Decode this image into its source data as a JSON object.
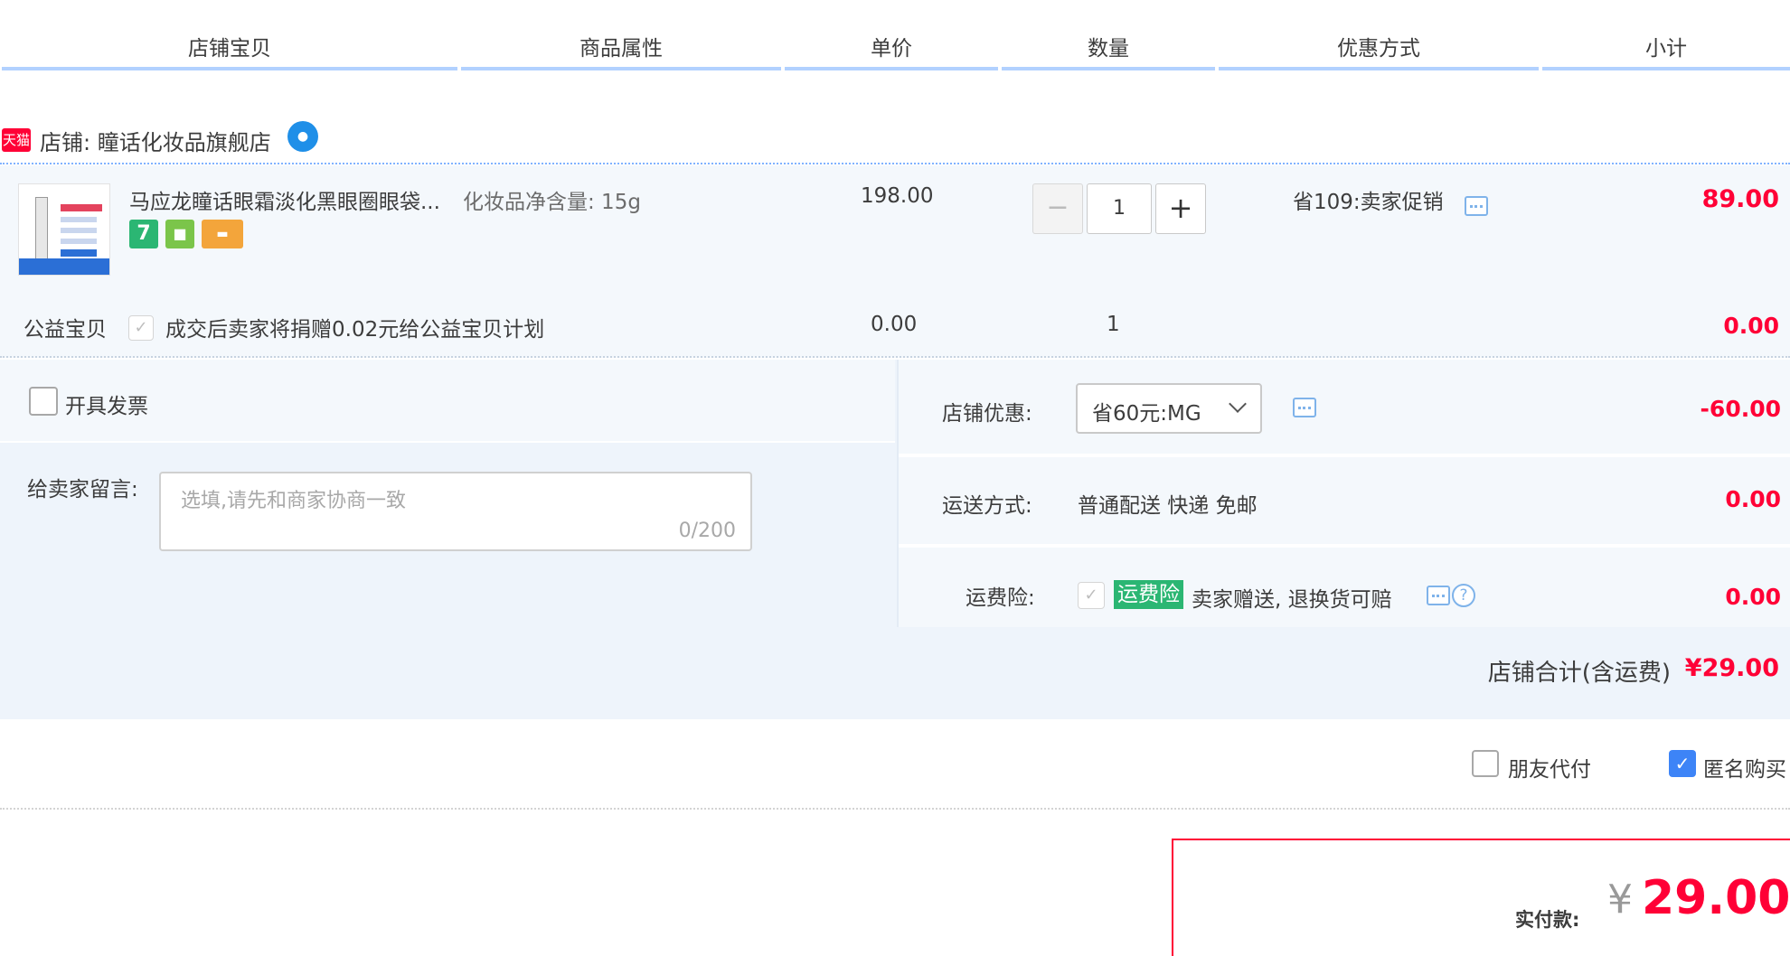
{
  "header": {
    "columns": [
      "店铺宝贝",
      "商品属性",
      "单价",
      "数量",
      "优惠方式",
      "小计"
    ]
  },
  "store": {
    "badge": "天猫",
    "name": "店铺: 瞳话化妆品旗舰店",
    "chat_icon": "wangwang-chat-icon"
  },
  "item": {
    "title": "马应龙瞳话眼霜淡化黑眼圈眼袋...",
    "service_icons": [
      "7",
      "bag",
      "card"
    ],
    "attribute": "化妆品净含量: 15g",
    "unit_price": "198.00",
    "quantity": "1",
    "promotion": "省109:卖家促销",
    "subtotal": "89.00"
  },
  "donation": {
    "label": "公益宝贝",
    "text": "成交后卖家将捐赠0.02元给公益宝贝计划",
    "unit_price": "0.00",
    "quantity": "1",
    "subtotal": "0.00"
  },
  "invoice": {
    "label": "开具发票"
  },
  "message": {
    "label": "给卖家留言:",
    "placeholder": "选填,请先和商家协商一致",
    "count": "0/200"
  },
  "store_discount": {
    "label": "店铺优惠:",
    "selected": "省60元:MG",
    "value": "-60.00"
  },
  "shipping": {
    "label": "运送方式:",
    "method": "普通配送 快递 免邮",
    "value": "0.00"
  },
  "insurance": {
    "label": "运费险:",
    "tag": "运费险",
    "text": "卖家赠送, 退换货可赔",
    "value": "0.00"
  },
  "store_total": {
    "label": "店铺合计(含运费)",
    "value": "¥29.00"
  },
  "options": {
    "friend_pay": "朋友代付",
    "anonymous": "匿名购买"
  },
  "pay": {
    "label": "实付款:",
    "currency": "¥",
    "amount": "29.00"
  },
  "colors": {
    "accent_red": "#ff0036",
    "header_line": "#b2d1ff",
    "row_bg": "#f4f8fc",
    "insurance_green": "#2bb673",
    "checkbox_blue": "#3d84f7"
  }
}
